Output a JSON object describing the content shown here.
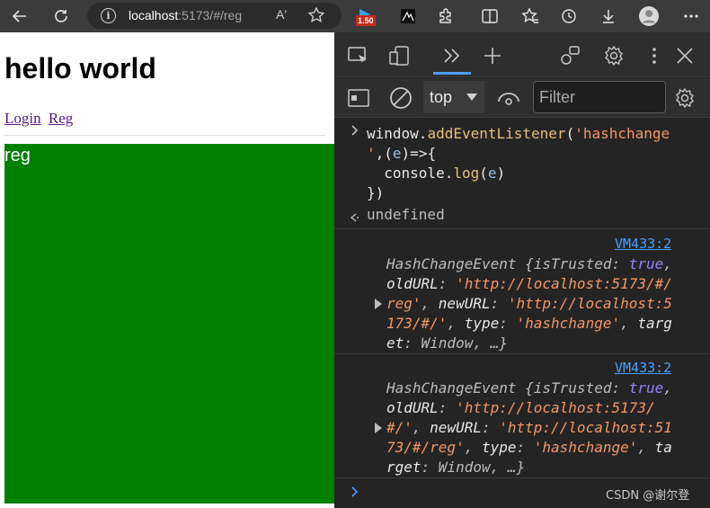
{
  "browser": {
    "url_host": "localhost",
    "url_rest": ":5173/#/reg",
    "extension_badge": "1.50",
    "icons": [
      "back-icon",
      "refresh-icon",
      "info-icon",
      "read-aloud-icon",
      "favorite-star-icon",
      "extensions-icon",
      "split-screen-icon",
      "favorites-icon",
      "history-icon",
      "downloads-icon",
      "profile-avatar-icon",
      "more-menu-icon"
    ],
    "read_aloud_label": "Aʹ"
  },
  "page": {
    "heading": "hello world",
    "links": [
      "Login",
      "Reg"
    ],
    "view_text": "reg",
    "view_color": "#008000"
  },
  "devtools": {
    "context": "top",
    "filter_placeholder": "Filter",
    "console": {
      "command_parts": {
        "obj": "window.",
        "method": "addEventListener",
        "open": "(",
        "str_a": "'hashchange",
        "str_b": "'",
        "after_str": ",(",
        "param": "e",
        "arrow": ")=>{",
        "indent_obj": "  console.",
        "log": "log",
        "log_open": "(",
        "log_param": "e",
        "log_close": ")",
        "close": "})"
      },
      "result": "undefined",
      "entries": [
        {
          "source": "VM433:2",
          "line1_a": "HashChangeEvent {",
          "line1_k": "isTrusted",
          "line1_c": ": ",
          "line1_v": "true",
          "line1_e": ",",
          "line2_k": "oldURL",
          "line2_c": ": ",
          "line2_v": "'http://localhost:5173/#/",
          "line3_v": "reg'",
          "line3_c": ", ",
          "line3_k": "newURL",
          "line3_c2": ": ",
          "line3_v2": "'http://localhost:5",
          "line4_v": "173/#/'",
          "line4_c": ", ",
          "line4_k": "type",
          "line4_c2": ": ",
          "line4_v2": "'hashchange'",
          "line4_c3": ", ",
          "line4_k2": "targ",
          "line5_k": "et",
          "line5_c": ": Window, …}"
        },
        {
          "source": "VM433:2",
          "line1_a": "HashChangeEvent {",
          "line1_k": "isTrusted",
          "line1_c": ": ",
          "line1_v": "true",
          "line1_e": ",",
          "line2_k": "oldURL",
          "line2_c": ": ",
          "line2_v": "'http://localhost:5173/",
          "line3_v": "#/'",
          "line3_c": ", ",
          "line3_k": "newURL",
          "line3_c2": ": ",
          "line3_v2": "'http://localhost:51",
          "line4_v": "73/#/reg'",
          "line4_c": ", ",
          "line4_k": "type",
          "line4_c2": ": ",
          "line4_v2": "'hashchange'",
          "line4_c3": ", ",
          "line4_k2": "ta",
          "line5_k": "rget",
          "line5_c": ": Window, …}"
        }
      ]
    },
    "watermark": "CSDN @谢尔登"
  }
}
